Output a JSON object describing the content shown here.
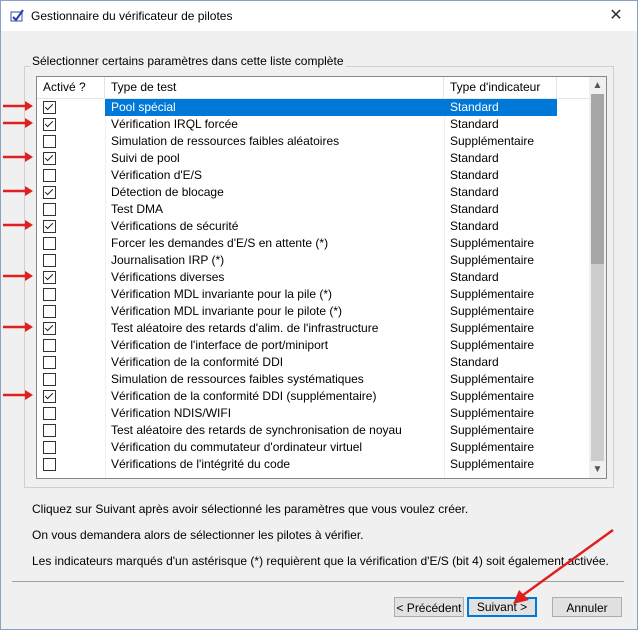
{
  "window": {
    "title": "Gestionnaire du vérificateur de pilotes",
    "close_glyph": "✕"
  },
  "group": {
    "label": "Sélectionner certains paramètres dans cette liste complète"
  },
  "table": {
    "headers": [
      "Activé ?",
      "Type de test",
      "Type d'indicateur"
    ],
    "rows": [
      {
        "checked": true,
        "test": "Pool spécial",
        "type": "Standard",
        "selected": true
      },
      {
        "checked": true,
        "test": "Vérification IRQL forcée",
        "type": "Standard"
      },
      {
        "checked": false,
        "test": "Simulation de ressources faibles aléatoires",
        "type": "Supplémentaire"
      },
      {
        "checked": true,
        "test": "Suivi de pool",
        "type": "Standard"
      },
      {
        "checked": false,
        "test": "Vérification d'E/S",
        "type": "Standard"
      },
      {
        "checked": true,
        "test": "Détection de blocage",
        "type": "Standard"
      },
      {
        "checked": false,
        "test": "Test DMA",
        "type": "Standard"
      },
      {
        "checked": true,
        "test": "Vérifications de sécurité",
        "type": "Standard"
      },
      {
        "checked": false,
        "test": "Forcer les demandes d'E/S en attente (*)",
        "type": "Supplémentaire"
      },
      {
        "checked": false,
        "test": "Journalisation IRP (*)",
        "type": "Supplémentaire"
      },
      {
        "checked": true,
        "test": "Vérifications diverses",
        "type": "Standard"
      },
      {
        "checked": false,
        "test": "Vérification MDL invariante pour la pile (*)",
        "type": "Supplémentaire"
      },
      {
        "checked": false,
        "test": "Vérification MDL invariante pour le pilote (*)",
        "type": "Supplémentaire"
      },
      {
        "checked": true,
        "test": "Test aléatoire des retards d'alim. de l'infrastructure",
        "type": "Supplémentaire"
      },
      {
        "checked": false,
        "test": "Vérification de l'interface de port/miniport",
        "type": "Supplémentaire"
      },
      {
        "checked": false,
        "test": "Vérification de la conformité DDI",
        "type": "Standard"
      },
      {
        "checked": false,
        "test": "Simulation de ressources faibles systématiques",
        "type": "Supplémentaire"
      },
      {
        "checked": true,
        "test": "Vérification de la conformité DDI (supplémentaire)",
        "type": "Supplémentaire"
      },
      {
        "checked": false,
        "test": "Vérification NDIS/WIFI",
        "type": "Supplémentaire"
      },
      {
        "checked": false,
        "test": "Test aléatoire des retards de synchronisation de noyau",
        "type": "Supplémentaire"
      },
      {
        "checked": false,
        "test": "Vérification du commutateur d'ordinateur virtuel",
        "type": "Supplémentaire"
      },
      {
        "checked": false,
        "test": "Vérifications de l'intégrité du code",
        "type": "Supplémentaire"
      }
    ]
  },
  "info": {
    "line1": "Cliquez sur Suivant après avoir sélectionné les paramètres que vous voulez créer.",
    "line2": "On vous demandera alors de sélectionner les pilotes à vérifier.",
    "line3": "Les indicateurs marqués d'un astérisque (*) requièrent que la vérification d'E/S (bit 4) soit également activée."
  },
  "buttons": {
    "back": "< Précédent",
    "next": "Suivant >",
    "cancel": "Annuler"
  },
  "colors": {
    "annotation_arrow": "#e02020",
    "selection": "#0078d7"
  }
}
